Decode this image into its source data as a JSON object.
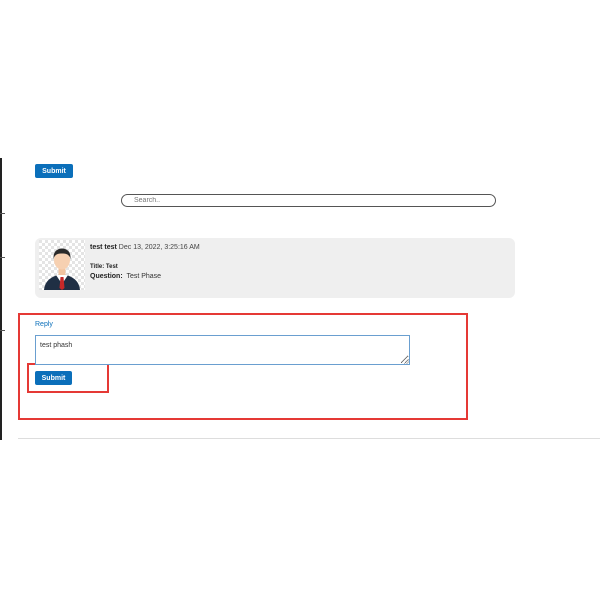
{
  "top_form": {
    "submit_label": "Submit"
  },
  "search": {
    "placeholder": "Search.."
  },
  "comment": {
    "author": "test test",
    "timestamp": "Dec 13, 2022, 3:25:16 AM",
    "title_label": "Title:",
    "title_value": "Test",
    "question_label": "Question:",
    "question_value": "Test Phase"
  },
  "reply": {
    "label": "Reply",
    "value": "test phash",
    "submit_label": "Submit"
  },
  "colors": {
    "button": "#0b6fba",
    "highlight": "#e53935",
    "card_background": "#efefef"
  },
  "icons": {
    "avatar": "businessman-avatar-icon"
  }
}
